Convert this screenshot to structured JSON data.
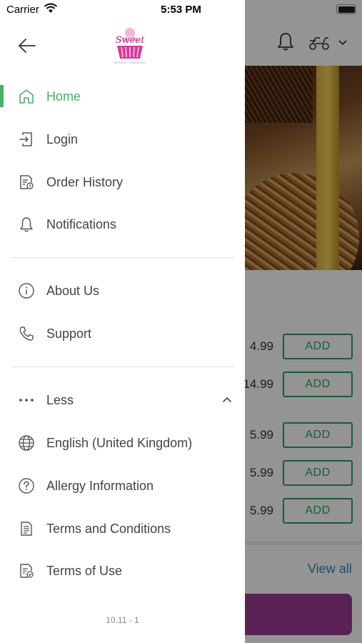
{
  "status_bar": {
    "carrier": "Carrier",
    "time": "5:53 PM"
  },
  "colors": {
    "accent_green": "#4cae6a",
    "add_green": "#2e9e5e",
    "link_blue": "#2a8ab8",
    "cta_purple": "#9b3c92"
  },
  "drawer": {
    "back_icon": "back-arrow-icon",
    "logo_text": "Sweet",
    "logo_tagline": "DESSERT PARADISE",
    "primary_items": [
      {
        "label": "Home",
        "icon": "home-icon",
        "active": true
      },
      {
        "label": "Login",
        "icon": "login-icon"
      },
      {
        "label": "Order History",
        "icon": "order-history-icon"
      },
      {
        "label": "Notifications",
        "icon": "bell-icon"
      }
    ],
    "secondary_items": [
      {
        "label": "About Us",
        "icon": "info-icon"
      },
      {
        "label": "Support",
        "icon": "phone-icon"
      }
    ],
    "more_toggle": {
      "label": "Less",
      "icon": "more-dots-icon",
      "expanded": true
    },
    "extra_items": [
      {
        "label": "English (United Kingdom)",
        "icon": "globe-icon"
      },
      {
        "label": "Allergy Information",
        "icon": "question-icon"
      },
      {
        "label": "Terms and Conditions",
        "icon": "document-icon"
      },
      {
        "label": "Terms of Use",
        "icon": "document-check-icon"
      }
    ],
    "version": "10.11 - 1"
  },
  "background": {
    "products": [
      {
        "price": "4.99",
        "add_label": "ADD"
      },
      {
        "price": "14.99",
        "add_label": "ADD"
      },
      {
        "price": "5.99",
        "add_label": "ADD"
      },
      {
        "price": "5.99",
        "add_label": "ADD"
      },
      {
        "price": "5.99",
        "add_label": "ADD"
      }
    ],
    "view_all_label": "View all"
  }
}
